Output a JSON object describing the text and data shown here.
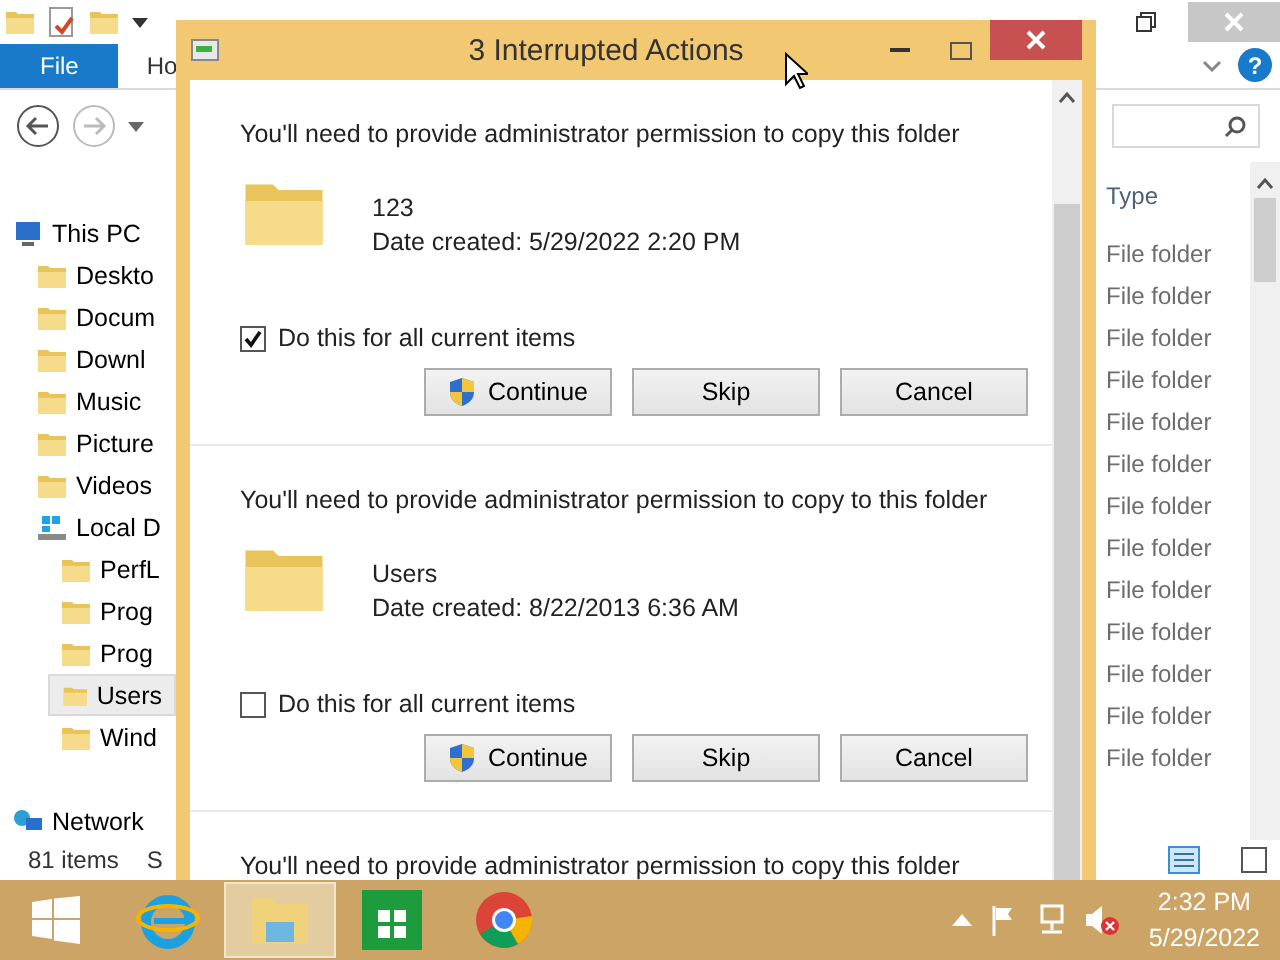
{
  "explorer": {
    "ribbon_tabs": [
      {
        "label": "File",
        "selected": true
      },
      {
        "label": "Ho",
        "selected": false
      }
    ],
    "help": "?",
    "nav_tree": [
      {
        "label": "This PC",
        "kind": "pc",
        "selected": false,
        "children": [
          {
            "label": "Deskto",
            "kind": "desktop",
            "selected": false
          },
          {
            "label": "Docum",
            "kind": "documents",
            "selected": false
          },
          {
            "label": "Downl",
            "kind": "downloads",
            "selected": false
          },
          {
            "label": "Music",
            "kind": "music",
            "selected": false
          },
          {
            "label": "Picture",
            "kind": "pictures",
            "selected": false
          },
          {
            "label": "Videos",
            "kind": "videos",
            "selected": false
          },
          {
            "label": "Local D",
            "kind": "drive",
            "selected": false,
            "children": [
              {
                "label": "PerfL",
                "kind": "folder",
                "selected": false
              },
              {
                "label": "Prog",
                "kind": "folder",
                "selected": false
              },
              {
                "label": "Prog",
                "kind": "folder",
                "selected": false
              },
              {
                "label": "Users",
                "kind": "folder",
                "selected": true
              },
              {
                "label": "Wind",
                "kind": "folder",
                "selected": false
              }
            ]
          }
        ]
      },
      {
        "label": "Network",
        "kind": "network",
        "selected": false
      }
    ],
    "type_column": {
      "header": "Type",
      "cells": [
        "File folder",
        "File folder",
        "File folder",
        "File folder",
        "File folder",
        "File folder",
        "File folder",
        "File folder",
        "File folder",
        "File folder",
        "File folder",
        "File folder",
        "File folder"
      ]
    },
    "status_bar": {
      "count": "81 items",
      "column_2": "S"
    }
  },
  "dialog": {
    "title": "3 Interrupted Actions",
    "items": [
      {
        "message": "You'll need to provide administrator permission to copy this folder",
        "name": "123",
        "date": "Date created: 5/29/2022 2:20 PM",
        "apply_all": {
          "label": "Do this for all current items",
          "checked": true
        },
        "buttons": [
          {
            "label": "Continue",
            "kind": "shield"
          },
          {
            "label": "Skip",
            "kind": "plain"
          },
          {
            "label": "Cancel",
            "kind": "plain"
          }
        ]
      },
      {
        "message": "You'll need to provide administrator permission to copy to this folder",
        "name": "Users",
        "date": "Date created: 8/22/2013 6:36 AM",
        "apply_all": {
          "label": "Do this for all current items",
          "checked": false
        },
        "buttons": [
          {
            "label": "Continue",
            "kind": "shield"
          },
          {
            "label": "Skip",
            "kind": "plain"
          },
          {
            "label": "Cancel",
            "kind": "plain"
          }
        ]
      },
      {
        "message": "You'll need to provide administrator permission to copy this folder"
      }
    ]
  },
  "taskbar": {
    "apps": [
      {
        "kind": "ie",
        "selected": false
      },
      {
        "kind": "explorer",
        "selected": true
      },
      {
        "kind": "store",
        "selected": false
      },
      {
        "kind": "chrome",
        "selected": false
      }
    ],
    "time": "2:32 PM",
    "date": "5/29/2022"
  }
}
